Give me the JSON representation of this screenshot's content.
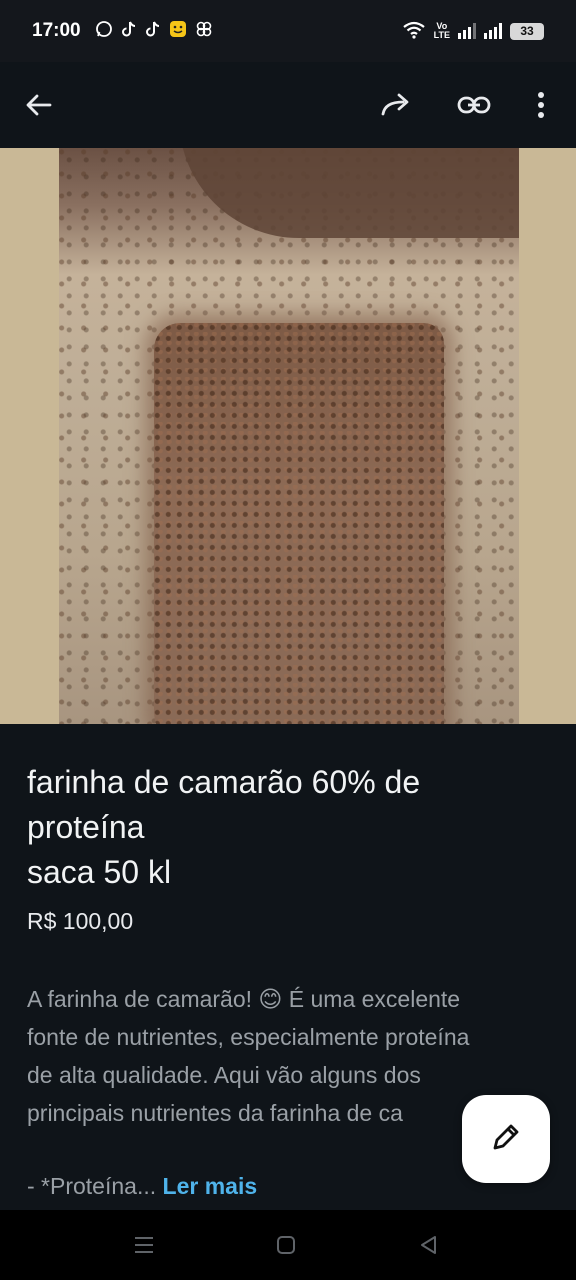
{
  "status_bar": {
    "time": "17:00",
    "app_icons": [
      "whatsapp-icon",
      "tiktok-icon",
      "tiktok-icon",
      "emoji-app-icon",
      "pinwheel-icon"
    ],
    "volte_top": "Vo",
    "volte_bottom": "LTE",
    "battery": "33"
  },
  "app_bar": {
    "icons": [
      "back-arrow-icon",
      "share-icon",
      "link-icon",
      "more-vert-icon"
    ]
  },
  "post": {
    "title": "farinha de camarão 60% de\nproteína\nsaca 50 kl",
    "price": "R$ 100,00",
    "description": "A farinha de camarão! 😊 É uma excelente\nfonte de nutrientes, especialmente proteína\nde alta qualidade. Aqui vão alguns dos\nprincipais nutrientes da farinha de ca",
    "more_prefix": "- *Proteína... ",
    "read_more": "Ler mais"
  },
  "fab": {
    "icon": "edit-pencil-icon"
  },
  "nav_bar": {
    "icons": [
      "recents-icon",
      "home-icon",
      "back-icon"
    ]
  },
  "colors": {
    "background": "#0f1419",
    "accent": "#4fb3ea"
  }
}
